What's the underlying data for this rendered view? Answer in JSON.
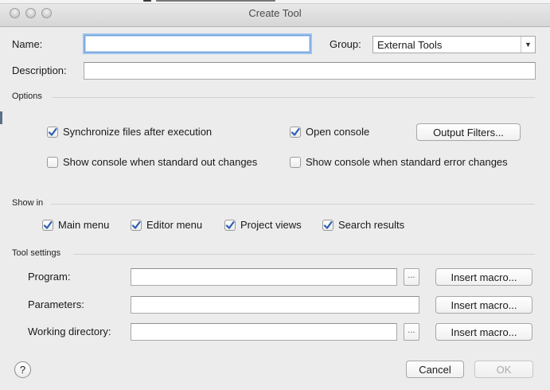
{
  "window": {
    "title": "Create Tool"
  },
  "form": {
    "name_label": "Name:",
    "name_value": "",
    "group_label": "Group:",
    "group_value": "External Tools",
    "description_label": "Description:",
    "description_value": ""
  },
  "options": {
    "section_label": "Options",
    "sync_files": {
      "label": "Synchronize files after execution",
      "checked": true
    },
    "open_console": {
      "label": "Open console",
      "checked": true
    },
    "output_filters_label": "Output Filters...",
    "show_console_stdout": {
      "label": "Show console when standard out changes",
      "checked": false
    },
    "show_console_stderr": {
      "label": "Show console when standard error changes",
      "checked": false
    }
  },
  "show_in": {
    "section_label": "Show in",
    "main_menu": {
      "label": "Main menu",
      "checked": true
    },
    "editor_menu": {
      "label": "Editor menu",
      "checked": true
    },
    "project_views": {
      "label": "Project views",
      "checked": true
    },
    "search_results": {
      "label": "Search results",
      "checked": true
    }
  },
  "tool_settings": {
    "section_label": "Tool settings",
    "program_label": "Program:",
    "program_value": "",
    "parameters_label": "Parameters:",
    "parameters_value": "",
    "working_directory_label": "Working directory:",
    "working_directory_value": "",
    "browse_label": "...",
    "insert_macro_label": "Insert macro..."
  },
  "footer": {
    "help_label": "?",
    "cancel_label": "Cancel",
    "ok_label": "OK",
    "ok_enabled": false
  },
  "colors": {
    "check_blue": "#2d5fb4",
    "focus_ring": "#9bc2ef"
  }
}
